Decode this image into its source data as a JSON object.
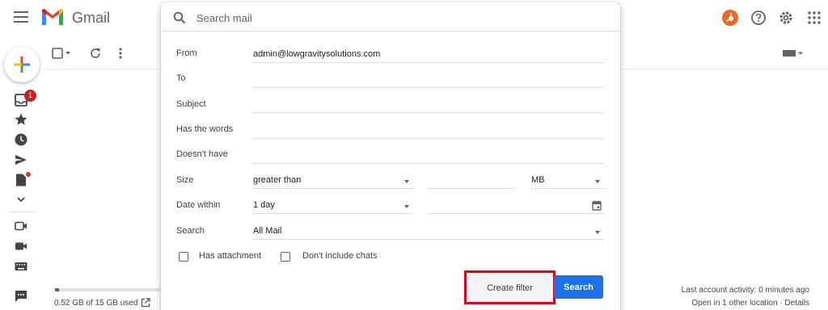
{
  "app": {
    "name": "Gmail"
  },
  "search": {
    "placeholder": "Search mail",
    "value": ""
  },
  "sidebar": {
    "inbox_badge": "1"
  },
  "storage": {
    "used_text": "0.52 GB of 15 GB used",
    "fraction": 0.035
  },
  "activity": {
    "last": "Last account activity: 0 minutes ago",
    "details": "Open in 1 other location · Details"
  },
  "filter_form": {
    "from_label": "From",
    "from_value": "admin@lowgravitysolutions.com",
    "to_label": "To",
    "to_value": "",
    "subject_label": "Subject",
    "subject_value": "",
    "has_words_label": "Has the words",
    "has_words_value": "",
    "doesnt_have_label": "Doesn't have",
    "doesnt_have_value": "",
    "size_label": "Size",
    "size_operator": "greater than",
    "size_value": "",
    "size_unit": "MB",
    "date_label": "Date within",
    "date_value": "1 day",
    "date_input": "",
    "search_label": "Search",
    "search_scope": "All Mail",
    "has_attachment_label": "Has attachment",
    "has_attachment_checked": false,
    "no_chats_label": "Don't include chats",
    "no_chats_checked": false,
    "create_filter_label": "Create filter",
    "search_button_label": "Search"
  },
  "colors": {
    "accent": "#1a73e8",
    "highlight_box": "#e3001b",
    "badge": "#c5221f",
    "avatar": "#f26522"
  },
  "icons": [
    "menu-icon",
    "gmail-logo",
    "search-icon",
    "support-icon",
    "settings-icon",
    "apps-icon",
    "compose-icon",
    "inbox-icon",
    "star-icon",
    "snoozed-icon",
    "sent-icon",
    "drafts-icon",
    "more-icon",
    "video-icon",
    "meet-icon",
    "keyboard-icon",
    "chat-icon",
    "refresh-icon",
    "more-vert-icon",
    "open-storage-icon",
    "calendar-icon"
  ]
}
